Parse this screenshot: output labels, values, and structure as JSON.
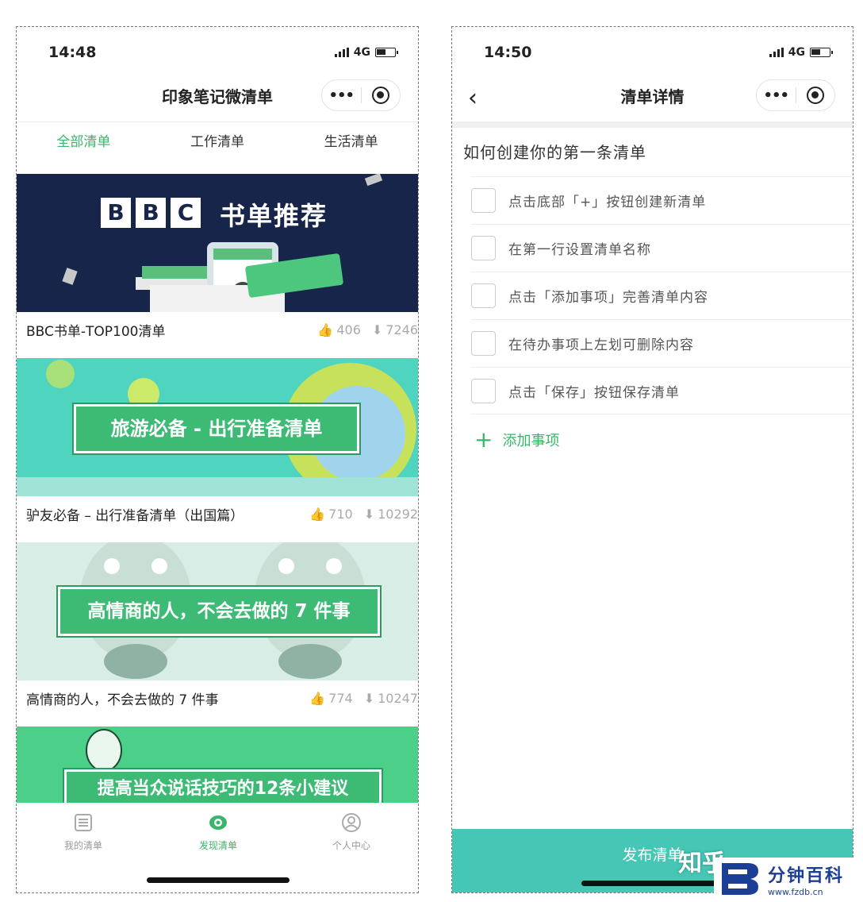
{
  "left": {
    "status": {
      "time": "14:48",
      "network": "4G"
    },
    "nav_title": "印象笔记微清单",
    "tabs": [
      "全部清单",
      "工作清单",
      "生活清单"
    ],
    "cards": [
      {
        "banner_text": "书单推荐",
        "banner_logo": "BBC",
        "title": "BBC书单-TOP100清单",
        "likes": "406",
        "downloads": "7246"
      },
      {
        "banner_text": "旅游必备 - 出行准备清单",
        "title": "驴友必备 – 出行准备清单（出国篇）",
        "likes": "710",
        "downloads": "10292"
      },
      {
        "banner_text": "高情商的人，不会去做的 7 件事",
        "title": "高情商的人，不会去做的 7 件事",
        "likes": "774",
        "downloads": "10247"
      },
      {
        "banner_text": "提高当众说话技巧的12条小建议"
      }
    ],
    "tabbar": [
      {
        "label": "我的清单",
        "icon": "list-icon"
      },
      {
        "label": "发现清单",
        "icon": "eye-icon"
      },
      {
        "label": "个人中心",
        "icon": "user-icon"
      }
    ]
  },
  "right": {
    "status": {
      "time": "14:50",
      "network": "4G"
    },
    "nav_title": "清单详情",
    "list_title": "如何创建你的第一条清单",
    "items": [
      "点击底部「+」按钮创建新清单",
      "在第一行设置清单名称",
      "点击「添加事项」完善清单内容",
      "在待办事项上左划可删除内容",
      "点击「保存」按钮保存清单"
    ],
    "add_item": "添加事项",
    "publish": "发布清单"
  },
  "watermark": {
    "zhihu": "知乎",
    "site_name": "分钟百科",
    "site_url": "www.fzdb.cn"
  },
  "colors": {
    "accent": "#3ab56a",
    "publish": "#46c6b4",
    "bbc_bg": "#18254a"
  }
}
